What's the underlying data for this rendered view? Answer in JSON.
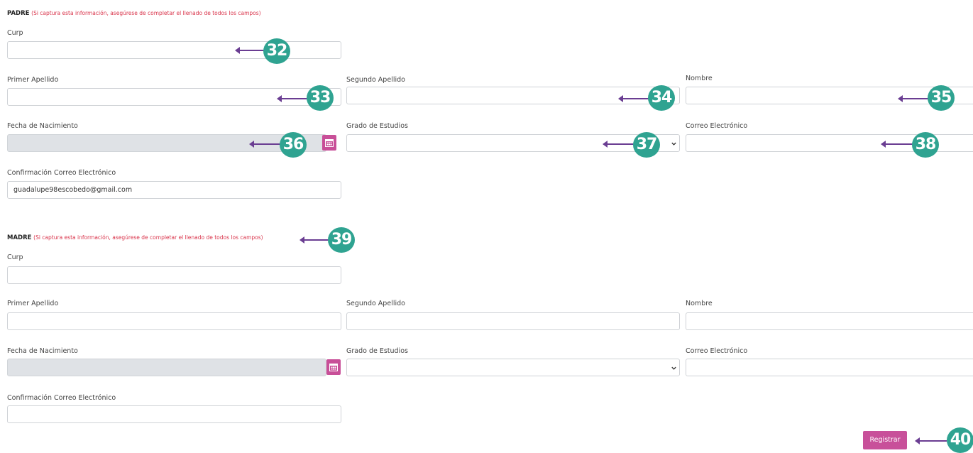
{
  "padre": {
    "title": "PADRE",
    "note": "(Si captura esta información, asegúrese de completar el llenado de todos los campos)",
    "curp_label": "Curp",
    "primer_apellido_label": "Primer Apellido",
    "segundo_apellido_label": "Segundo Apellido",
    "nombre_label": "Nombre",
    "fecha_label": "Fecha de Nacimiento",
    "grado_label": "Grado de Estudios",
    "correo_label": "Correo Electrónico",
    "confirm_label": "Confirmación Correo Electrónico",
    "confirm_value": "guadalupe98escobedo@gmail.com"
  },
  "madre": {
    "title": "MADRE",
    "note": "(Si captura esta información, asegúrese de completar el llenado de todos los campos)",
    "curp_label": "Curp",
    "primer_apellido_label": "Primer Apellido",
    "segundo_apellido_label": "Segundo Apellido",
    "nombre_label": "Nombre",
    "fecha_label": "Fecha de Nacimiento",
    "grado_label": "Grado de Estudios",
    "correo_label": "Correo Electrónico",
    "confirm_label": "Confirmación Correo Electrónico"
  },
  "actions": {
    "register_label": "Registrar"
  },
  "annotations": [
    "32",
    "33",
    "34",
    "35",
    "36",
    "37",
    "38",
    "39",
    "40"
  ],
  "colors": {
    "accent": "#c8509a",
    "annotation": "#2fa391",
    "arrow": "#6a3d92",
    "note": "#d9334a"
  }
}
